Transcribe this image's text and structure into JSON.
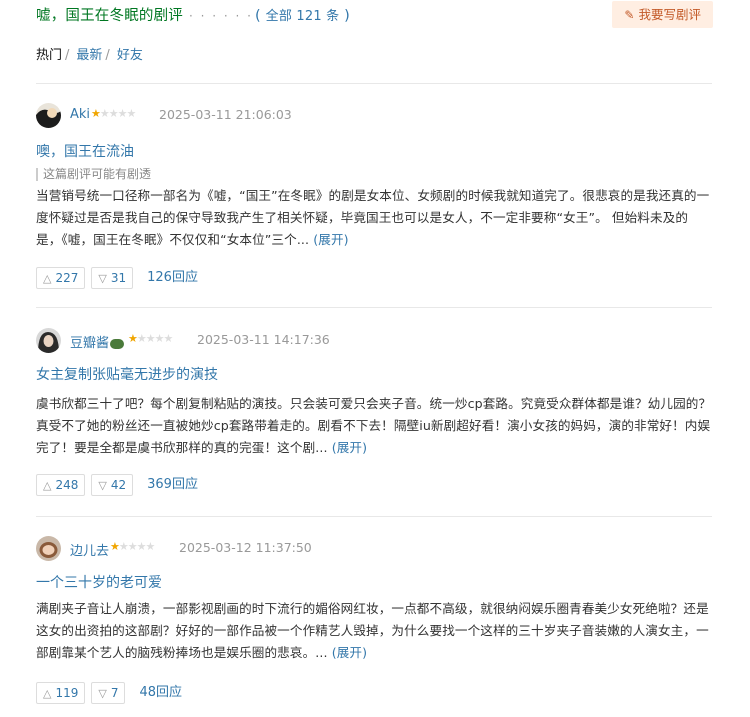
{
  "header": {
    "title": "嘘，国王在冬眠的剧评",
    "dots": "· · · · · ·",
    "count_prefix": "( ",
    "count_text": "全部 121 条",
    "count_suffix": " )",
    "write_button": "我要写剧评",
    "write_icon": "pencil-icon"
  },
  "filters": {
    "hot": "热门",
    "latest": "最新",
    "friends": "好友",
    "separator": "/"
  },
  "reviews": [
    {
      "username": "Aki",
      "stars_on": "★",
      "stars_off": "★★★★",
      "time": "2025-03-11 21:06:03",
      "title": "噢，国王在流油",
      "spoiler": "这篇剧评可能有剧透",
      "body": "当营销号统一口径称一部名为《嘘，“国王”在冬眠》的剧是女本位、女频剧的时候我就知道完了。很悲哀的是我还真的一度怀疑过是否是我自己的保守导致我产生了相关怀疑，毕竟国王也可以是女人，不一定非要称“女王”。 但始料未及的是，《嘘，国王在冬眠》不仅仅和“女本位”三个...",
      "expand": "(展开)",
      "up": "227",
      "down": "31",
      "replies": "126回应"
    },
    {
      "username": "豆瓣酱",
      "stars_on": "★",
      "stars_off": "★★★★",
      "time": "2025-03-11 14:17:36",
      "title": "女主复制张贴毫无进步的演技",
      "spoiler": "",
      "body": "虞书欣都三十了吧？每个剧复制粘贴的演技。只会装可爱只会夹子音。统一炒cp套路。究竟受众群体都是谁？幼儿园的？真受不了她的粉丝还一直被她炒cp套路带着走的。剧看不下去！隔壁iu新剧超好看！演小女孩的妈妈，演的非常好！内娱完了！要是全都是虞书欣那样的真的完蛋！这个剧...",
      "expand": "(展开)",
      "up": "248",
      "down": "42",
      "replies": "369回应"
    },
    {
      "username": "边儿去",
      "stars_on": "★",
      "stars_off": "★★★★",
      "time": "2025-03-12 11:37:50",
      "title": "一个三十岁的老可爱",
      "spoiler": "",
      "body": "满剧夹子音让人崩溃，一部影视剧画的时下流行的媚俗网红妆，一点都不高级，就很纳闷娱乐圈青春美少女死绝啦？还是这女的出资拍的这部剧？好好的一部作品被一个作精艺人毁掉，为什么要找一个这样的三十岁夹子音装嫩的人演女主，一部剧靠某个艺人的脑残粉捧场也是娱乐圈的悲哀。...",
      "expand": "(展开)",
      "up": "119",
      "down": "7",
      "replies": "48回应"
    }
  ]
}
